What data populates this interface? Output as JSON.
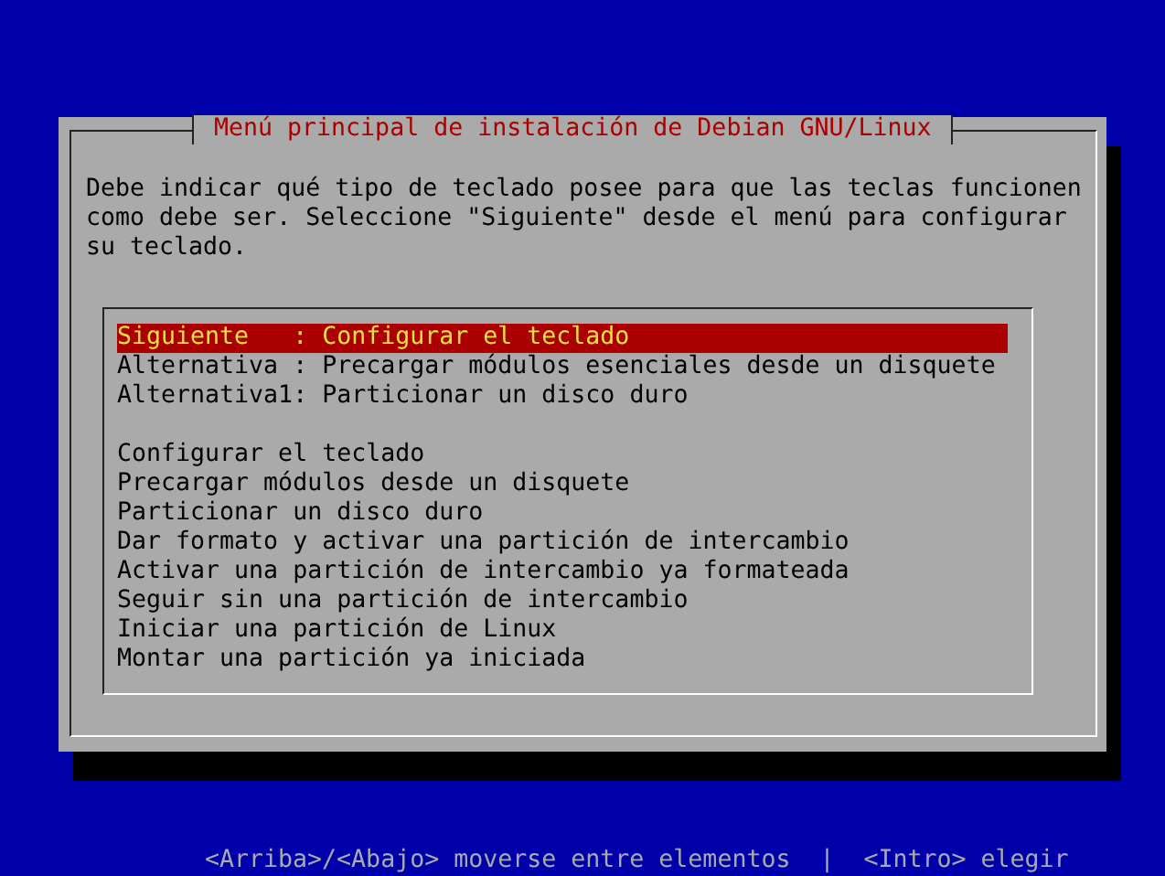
{
  "dialog": {
    "title": "Menú principal de instalación de Debian GNU/Linux",
    "message": "Debe indicar qué tipo de teclado posee para que las teclas funcionen\ncomo debe ser. Seleccione \"Siguiente\" desde el menú para configurar\nsu teclado.",
    "menu": {
      "groups": [
        [
          {
            "label": "Siguiente   : Configurar el teclado",
            "selected": true
          },
          {
            "label": "Alternativa : Precargar módulos esenciales desde un disquete",
            "selected": false
          },
          {
            "label": "Alternativa1: Particionar un disco duro",
            "selected": false
          }
        ],
        [
          {
            "label": "Configurar el teclado",
            "selected": false
          },
          {
            "label": "Precargar módulos desde un disquete",
            "selected": false
          },
          {
            "label": "Particionar un disco duro",
            "selected": false
          },
          {
            "label": "Dar formato y activar una partición de intercambio",
            "selected": false
          },
          {
            "label": "Activar una partición de intercambio ya formateada",
            "selected": false
          },
          {
            "label": "Seguir sin una partición de intercambio",
            "selected": false
          },
          {
            "label": "Iniciar una partición de Linux",
            "selected": false
          },
          {
            "label": "Montar una partición ya iniciada",
            "selected": false
          }
        ]
      ]
    }
  },
  "footer": [
    "<Arriba>/<Abajo> moverse entre elementos",
    "|",
    "<Intro> elegir"
  ]
}
